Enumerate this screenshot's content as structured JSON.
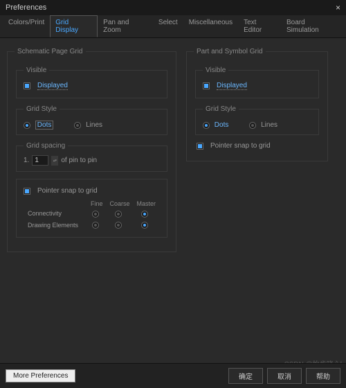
{
  "window": {
    "title": "Preferences"
  },
  "tabs": [
    "Colors/Print",
    "Grid Display",
    "Pan and Zoom",
    "Select",
    "Miscellaneous",
    "Text Editor",
    "Board Simulation"
  ],
  "active_tab": 1,
  "left": {
    "group": "Schematic Page Grid",
    "visible": {
      "legend": "Visible",
      "label": "Displayed",
      "checked": true
    },
    "style": {
      "legend": "Grid Style",
      "opts": [
        "Dots",
        "Lines"
      ],
      "selected": 0
    },
    "spacing": {
      "legend": "Grid spacing",
      "value": "1",
      "suffix": "of pin to pin"
    },
    "snap": {
      "label": "Pointer snap to grid",
      "checked": true,
      "cols": [
        "Fine",
        "Coarse",
        "Master"
      ],
      "rows": [
        {
          "name": "Connectivity",
          "sel": 2
        },
        {
          "name": "Drawing Elements",
          "sel": 2
        }
      ]
    }
  },
  "right": {
    "group": "Part and Symbol Grid",
    "visible": {
      "legend": "Visible",
      "label": "Displayed",
      "checked": true
    },
    "style": {
      "legend": "Grid Style",
      "opts": [
        "Dots",
        "Lines"
      ],
      "selected": 0
    },
    "snap": {
      "label": "Pointer snap to grid",
      "checked": true
    }
  },
  "footer": {
    "more": "More Preferences",
    "ok": "确定",
    "cancel": "取消",
    "help": "帮助"
  },
  "watermark": "CSDN @怡步晓心l"
}
